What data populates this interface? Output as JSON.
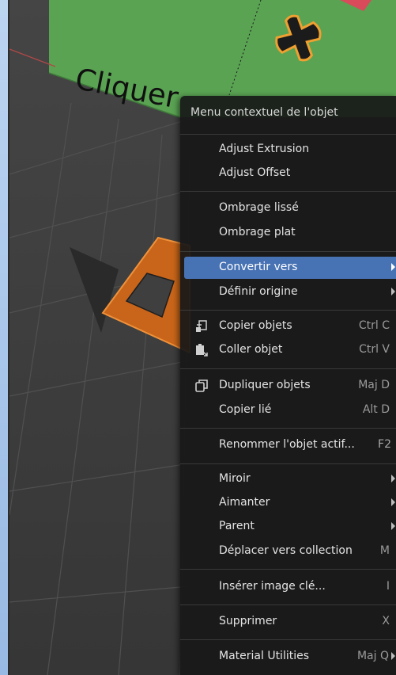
{
  "viewport": {
    "canvas_text": "Cliquer"
  },
  "menu": {
    "title": "Menu contextuel de l'objet",
    "groups": [
      {
        "items": [
          {
            "label": "Adjust Extrusion"
          },
          {
            "label": "Adjust Offset"
          }
        ]
      },
      {
        "items": [
          {
            "label": "Ombrage lissé"
          },
          {
            "label": "Ombrage plat"
          }
        ]
      },
      {
        "items": [
          {
            "label": "Convertir vers",
            "submenu": true,
            "highlighted": true
          },
          {
            "label": "Définir origine",
            "submenu": true
          }
        ]
      },
      {
        "items": [
          {
            "label": "Copier objets",
            "shortcut": "Ctrl C",
            "icon": "copy-objects-icon"
          },
          {
            "label": "Coller objet",
            "shortcut": "Ctrl V",
            "icon": "paste-object-icon"
          }
        ]
      },
      {
        "items": [
          {
            "label": "Dupliquer objets",
            "shortcut": "Maj D",
            "icon": "duplicate-icon"
          },
          {
            "label": "Copier lié",
            "shortcut": "Alt D"
          }
        ]
      },
      {
        "items": [
          {
            "label": "Renommer l'objet actif...",
            "shortcut": "F2"
          }
        ]
      },
      {
        "items": [
          {
            "label": "Miroir",
            "submenu": true
          },
          {
            "label": "Aimanter",
            "submenu": true
          },
          {
            "label": "Parent",
            "submenu": true
          },
          {
            "label": "Déplacer vers collection",
            "shortcut": "M"
          }
        ]
      },
      {
        "items": [
          {
            "label": "Insérer image clé...",
            "shortcut": "I"
          }
        ]
      },
      {
        "items": [
          {
            "label": "Supprimer",
            "shortcut": "X"
          }
        ]
      },
      {
        "items": [
          {
            "label": "Material Utilities",
            "shortcut": "Maj Q",
            "submenu": true
          }
        ]
      }
    ]
  },
  "colors": {
    "highlight": "#4772b3",
    "menu_bg": "#181818",
    "plane_green": "#5aa353",
    "selection_orange": "#e07a1f"
  }
}
